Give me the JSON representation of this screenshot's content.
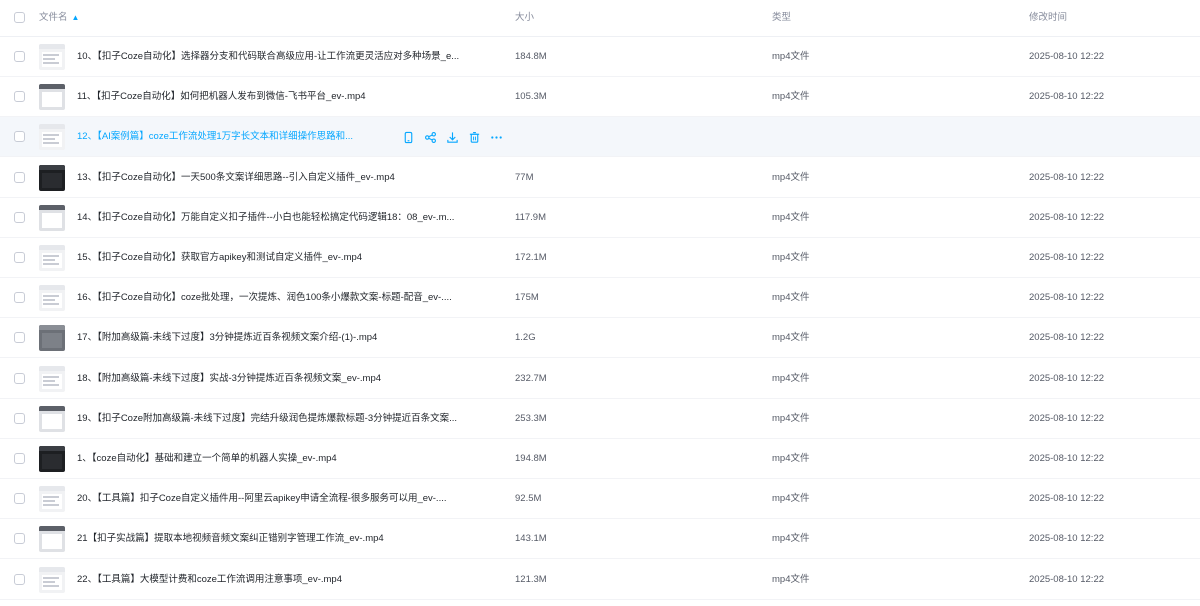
{
  "header": {
    "name": "文件名",
    "size": "大小",
    "type": "类型",
    "modified": "修改时间"
  },
  "files": [
    {
      "name": "10、【扣子Coze自动化】选择器分支和代码联合高级应用-让工作流更灵活应对多种场景_e...",
      "size": "184.8M",
      "type": "mp4文件",
      "time": "2025-08-10 12:22",
      "thumb": "light"
    },
    {
      "name": "11、【扣子Coze自动化】如何把机器人发布到微信-飞书平台_ev-.mp4",
      "size": "105.3M",
      "type": "mp4文件",
      "time": "2025-08-10 12:22",
      "thumb": "frame"
    },
    {
      "name": "12、【AI案例篇】coze工作流处理1万字长文本和详细操作思路和...",
      "size": "",
      "type": "",
      "time": "",
      "thumb": "light",
      "hover": true
    },
    {
      "name": "13、【扣子Coze自动化】一天500条文案详细思路--引入自定义插件_ev-.mp4",
      "size": "77M",
      "type": "mp4文件",
      "time": "2025-08-10 12:22",
      "thumb": "dark"
    },
    {
      "name": "14、【扣子Coze自动化】万能自定义扣子插件--小白也能轻松搞定代码逻辑18：08_ev-.m...",
      "size": "117.9M",
      "type": "mp4文件",
      "time": "2025-08-10 12:22",
      "thumb": "frame"
    },
    {
      "name": "15、【扣子Coze自动化】获取官方apikey和测试自定义插件_ev-.mp4",
      "size": "172.1M",
      "type": "mp4文件",
      "time": "2025-08-10 12:22",
      "thumb": "light"
    },
    {
      "name": "16、【扣子Coze自动化】coze批处理，一次提炼、润色100条小爆款文案-标题-配音_ev-....",
      "size": "175M",
      "type": "mp4文件",
      "time": "2025-08-10 12:22",
      "thumb": "light"
    },
    {
      "name": "17、【附加高级篇-未线下过度】3分钟提炼近百条视频文案介绍-(1)-.mp4",
      "size": "1.2G",
      "type": "mp4文件",
      "time": "2025-08-10 12:22",
      "thumb": "gray"
    },
    {
      "name": "18、【附加高级篇-未线下过度】实战-3分钟提炼近百条视频文案_ev-.mp4",
      "size": "232.7M",
      "type": "mp4文件",
      "time": "2025-08-10 12:22",
      "thumb": "light"
    },
    {
      "name": "19、【扣子Coze附加高级篇-未线下过度】完结升级润色提炼爆款标题-3分钟提近百条文案...",
      "size": "253.3M",
      "type": "mp4文件",
      "time": "2025-08-10 12:22",
      "thumb": "frame"
    },
    {
      "name": "1、【coze自动化】基础和建立一个简单的机器人实操_ev-.mp4",
      "size": "194.8M",
      "type": "mp4文件",
      "time": "2025-08-10 12:22",
      "thumb": "dark"
    },
    {
      "name": "20、【工具篇】扣子Coze自定义插件用--阿里云apikey申请全流程-很多服务可以用_ev-....",
      "size": "92.5M",
      "type": "mp4文件",
      "time": "2025-08-10 12:22",
      "thumb": "light"
    },
    {
      "name": "21【扣子实战篇】提取本地视频音频文案纠正错别字管理工作流_ev-.mp4",
      "size": "143.1M",
      "type": "mp4文件",
      "time": "2025-08-10 12:22",
      "thumb": "frame"
    },
    {
      "name": "22、【工具篇】大模型计费和coze工作流调用注意事项_ev-.mp4",
      "size": "121.3M",
      "type": "mp4文件",
      "time": "2025-08-10 12:22",
      "thumb": "light"
    }
  ],
  "icons": {
    "sort": "arrow-up-icon",
    "actions": [
      "phone-icon",
      "share-icon",
      "download-icon",
      "trash-icon",
      "more-icon"
    ]
  },
  "colors": {
    "accent": "#06a7ff",
    "hover_bg": "#f4f7fb"
  }
}
